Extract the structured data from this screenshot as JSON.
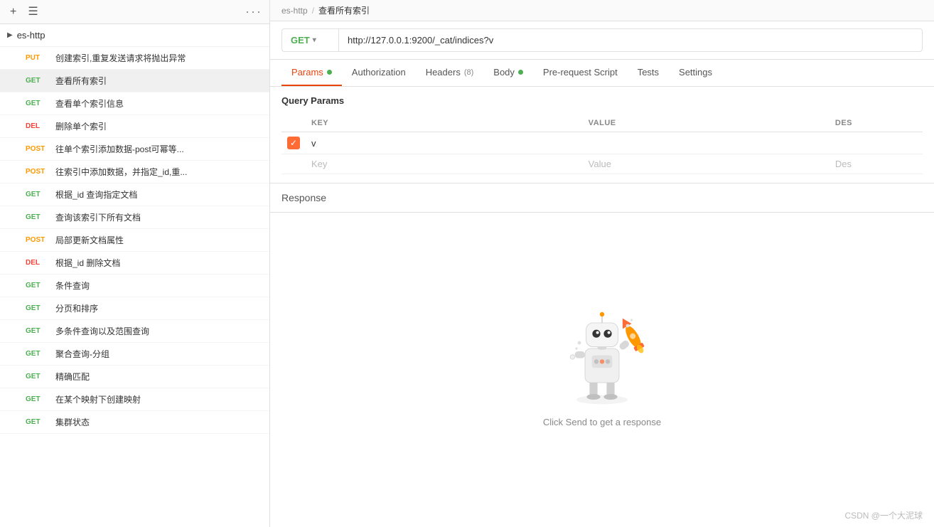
{
  "sidebar": {
    "top_icons": {
      "plus": "+",
      "filter": "☰",
      "dots": "···"
    },
    "collection": {
      "name": "es-http",
      "chevron": "▶"
    },
    "items": [
      {
        "method": "PUT",
        "label": "创建索引,重复发送请求将抛出异常",
        "type": "put"
      },
      {
        "method": "GET",
        "label": "查看所有索引",
        "type": "get",
        "active": true
      },
      {
        "method": "GET",
        "label": "查看单个索引信息",
        "type": "get"
      },
      {
        "method": "DEL",
        "label": "删除单个索引",
        "type": "delete"
      },
      {
        "method": "POST",
        "label": "往单个索引添加数据-post可幂等...",
        "type": "post"
      },
      {
        "method": "POST",
        "label": "往索引中添加数据，并指定_id,重...",
        "type": "post"
      },
      {
        "method": "GET",
        "label": "根据_id 查询指定文档",
        "type": "get"
      },
      {
        "method": "GET",
        "label": "查询该索引下所有文档",
        "type": "get"
      },
      {
        "method": "POST",
        "label": "局部更新文档属性",
        "type": "post"
      },
      {
        "method": "DEL",
        "label": "根据_id 删除文档",
        "type": "delete"
      },
      {
        "method": "GET",
        "label": "条件查询",
        "type": "get"
      },
      {
        "method": "GET",
        "label": "分页和排序",
        "type": "get"
      },
      {
        "method": "GET",
        "label": "多条件查询以及范围查询",
        "type": "get"
      },
      {
        "method": "GET",
        "label": "聚合查询-分组",
        "type": "get"
      },
      {
        "method": "GET",
        "label": "精确匹配",
        "type": "get"
      },
      {
        "method": "GET",
        "label": "在某个映射下创建映射",
        "type": "get"
      },
      {
        "method": "GET",
        "label": "集群状态",
        "type": "get"
      }
    ]
  },
  "main": {
    "breadcrumb": {
      "collection": "es-http",
      "separator": "/",
      "current": "查看所有索引"
    },
    "url_bar": {
      "method": "GET",
      "chevron": "▾",
      "url": "http://127.0.0.1:9200/_cat/indices?v"
    },
    "tabs": [
      {
        "id": "params",
        "label": "Params",
        "dot": "green",
        "active": true
      },
      {
        "id": "authorization",
        "label": "Authorization",
        "dot": null,
        "active": false
      },
      {
        "id": "headers",
        "label": "Headers",
        "badge": "(8)",
        "dot": null,
        "active": false
      },
      {
        "id": "body",
        "label": "Body",
        "dot": "green",
        "active": false
      },
      {
        "id": "pre-request",
        "label": "Pre-request Script",
        "dot": null,
        "active": false
      },
      {
        "id": "tests",
        "label": "Tests",
        "dot": null,
        "active": false
      },
      {
        "id": "settings",
        "label": "Settings",
        "dot": null,
        "active": false
      }
    ],
    "params": {
      "section_title": "Query Params",
      "columns": [
        "KEY",
        "VALUE",
        "DES"
      ],
      "rows": [
        {
          "checked": true,
          "key": "v",
          "value": "",
          "desc": ""
        }
      ],
      "placeholder_row": {
        "key": "Key",
        "value": "Value",
        "desc": "Des"
      }
    },
    "response": {
      "title": "Response",
      "placeholder_text": "Click Send to get a response"
    },
    "footer": {
      "credit": "CSDN @一个大泥球"
    }
  }
}
